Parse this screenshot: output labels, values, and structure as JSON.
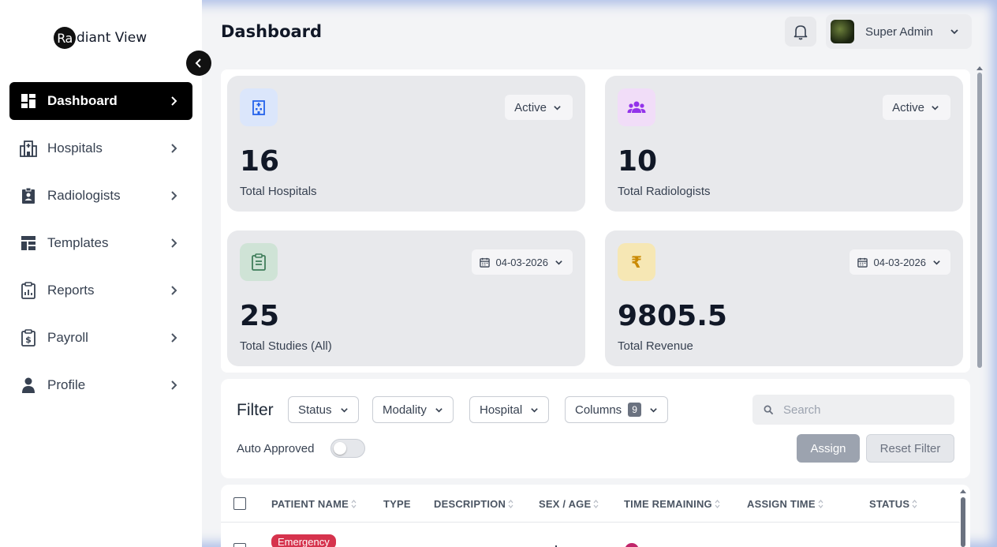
{
  "brand": {
    "logo_mark": "Ra",
    "logo_rest": "diant View"
  },
  "sidebar": {
    "items": [
      {
        "label": "Dashboard",
        "icon": "dashboard-icon",
        "active": true
      },
      {
        "label": "Hospitals",
        "icon": "hospital-icon"
      },
      {
        "label": "Radiologists",
        "icon": "id-badge-icon"
      },
      {
        "label": "Templates",
        "icon": "template-icon"
      },
      {
        "label": "Reports",
        "icon": "clipboard-icon"
      },
      {
        "label": "Payroll",
        "icon": "payroll-icon"
      },
      {
        "label": "Profile",
        "icon": "user-icon"
      }
    ]
  },
  "header": {
    "title": "Dashboard",
    "user_name": "Super Admin"
  },
  "stats": [
    {
      "value": "16",
      "label": "Total Hospitals",
      "control": "Active",
      "icon_bg": "#dbe6fb",
      "icon_color": "#2563eb"
    },
    {
      "value": "10",
      "label": "Total Radiologists",
      "control": "Active",
      "icon_bg": "#f1ddf8",
      "icon_color": "#9333ea"
    },
    {
      "value": "25",
      "label": "Total Studies (All)",
      "control": "04-03-2026",
      "icon_bg": "#cfe3d6",
      "icon_color": "#3f7d5a"
    },
    {
      "value": "9805.5",
      "label": "Total Revenue",
      "control": "04-03-2026",
      "icon_bg": "#f6e7b4",
      "icon_color": "#ca8a04"
    }
  ],
  "filter": {
    "title": "Filter",
    "status_label": "Status",
    "modality_label": "Modality",
    "hospital_label": "Hospital",
    "columns_label": "Columns",
    "columns_count": "9",
    "search_placeholder": "Search",
    "auto_approved_label": "Auto Approved",
    "auto_approved_on": false,
    "assign_label": "Assign",
    "reset_label": "Reset Filter"
  },
  "table": {
    "columns": [
      "PATIENT NAME",
      "TYPE",
      "DESCRIPTION",
      "SEX / AGE",
      "TIME REMAINING",
      "ASSIGN TIME",
      "STATUS"
    ],
    "first_row_tag": "Emergency"
  }
}
